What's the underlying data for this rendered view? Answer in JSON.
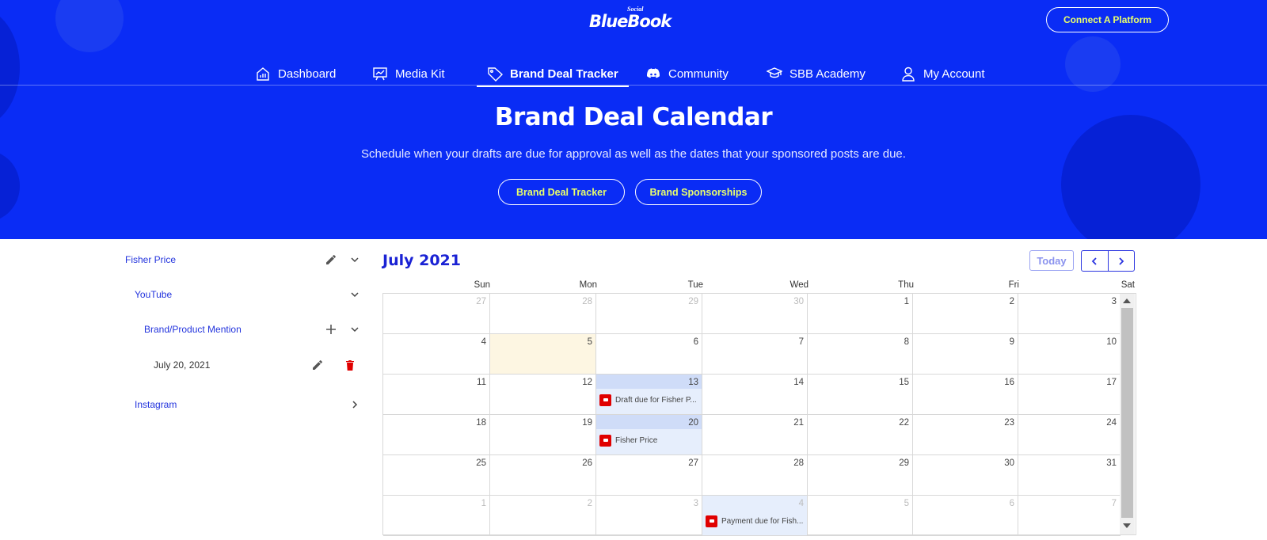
{
  "app": {
    "logo_main": "BlueBook",
    "logo_small": "Social",
    "connect_label": "Connect A Platform"
  },
  "nav": {
    "items": [
      {
        "label": "Dashboard",
        "icon": "home-chart-icon"
      },
      {
        "label": "Media Kit",
        "icon": "presentation-icon"
      },
      {
        "label": "Brand Deal Tracker",
        "icon": "tag-icon",
        "active": true
      },
      {
        "label": "Community",
        "icon": "discord-icon"
      },
      {
        "label": "SBB Academy",
        "icon": "graduation-cap-icon"
      },
      {
        "label": "My Account",
        "icon": "user-icon"
      }
    ]
  },
  "hero": {
    "title": "Brand Deal Calendar",
    "subtitle": "Schedule when your drafts are due for approval as well as the dates that your sponsored posts are due.",
    "button1": "Brand Deal Tracker",
    "button2": "Brand Sponsorships"
  },
  "tree": {
    "brand": "Fisher Price",
    "platform1": "YouTube",
    "deal_type": "Brand/Product Mention",
    "deal_date": "July 20, 2021",
    "platform2": "Instagram"
  },
  "calendar": {
    "month_label": "July 2021",
    "today_label": "Today",
    "weekdays": [
      "Sun",
      "Mon",
      "Tue",
      "Wed",
      "Thu",
      "Fri",
      "Sat"
    ],
    "weeks": [
      [
        "27",
        "28",
        "29",
        "30",
        "1",
        "2",
        "3"
      ],
      [
        "4",
        "5",
        "6",
        "7",
        "8",
        "9",
        "10"
      ],
      [
        "11",
        "12",
        "13",
        "14",
        "15",
        "16",
        "17"
      ],
      [
        "18",
        "19",
        "20",
        "21",
        "22",
        "23",
        "24"
      ],
      [
        "25",
        "26",
        "27",
        "28",
        "29",
        "30",
        "31"
      ],
      [
        "1",
        "2",
        "3",
        "4",
        "5",
        "6",
        "7"
      ]
    ],
    "events": {
      "draft": "Draft due for Fisher P...",
      "post": "Fisher Price",
      "payment": "Payment due for Fish..."
    }
  },
  "colors": {
    "hero_bg": "#0a2cf5",
    "accent_yellow": "#e9ff6b",
    "title_blue": "#1a22d4",
    "youtube_red": "#e00000"
  }
}
